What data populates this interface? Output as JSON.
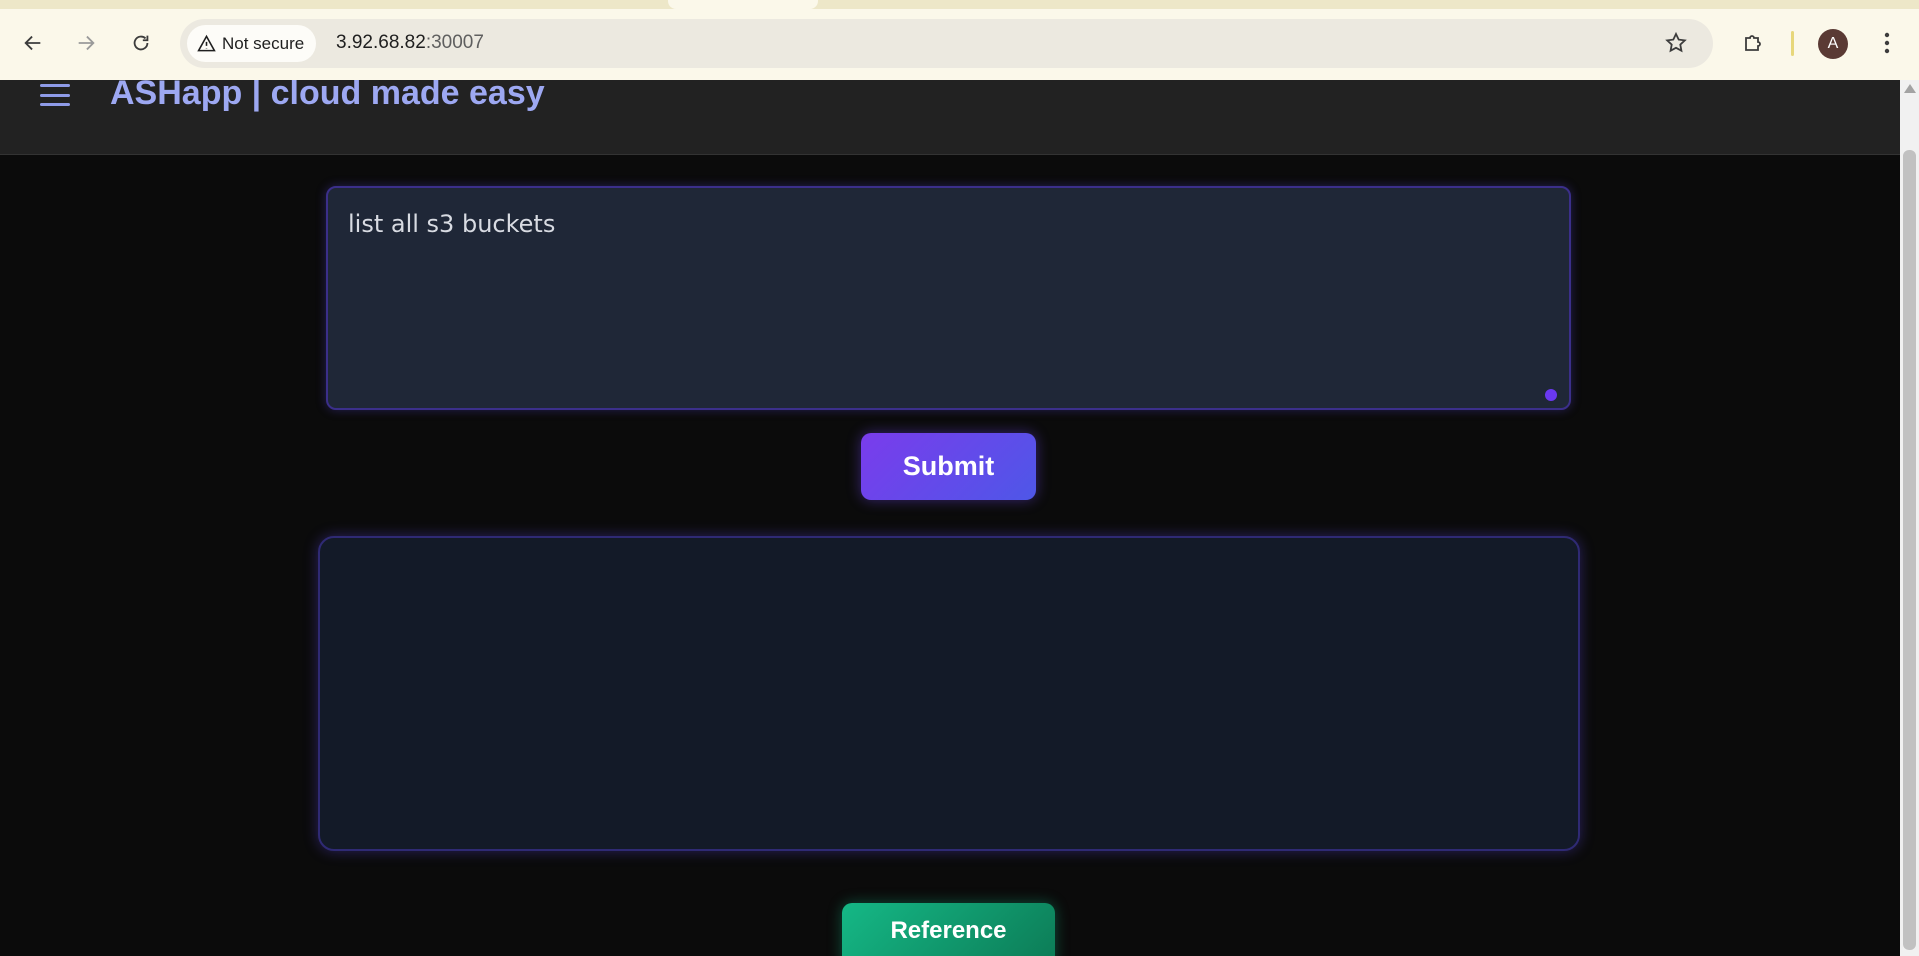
{
  "browser": {
    "security_label": "Not secure",
    "url_host": "3.92.68.82",
    "url_port": ":30007",
    "profile_initial": "A",
    "icons": {
      "back": "arrow-left-icon",
      "forward": "arrow-right-icon",
      "reload": "reload-icon",
      "security": "warning-triangle-icon",
      "bookmark": "star-icon",
      "extensions": "puzzle-icon",
      "menu": "more-vertical-icon"
    }
  },
  "app": {
    "title": "ASHapp | cloud made easy",
    "menu_icon": "hamburger-icon"
  },
  "main": {
    "prompt_value": "list all s3 buckets",
    "submit_label": "Submit",
    "output_text": "",
    "reference_label": "Reference"
  },
  "colors": {
    "title": "#9da8f2",
    "submit_gradient": [
      "#7a3cec",
      "#4e57e8"
    ],
    "reference_gradient": [
      "#15b886",
      "#0c7a55"
    ],
    "page_bg": "#0b0b0b",
    "header_bg": "#222222"
  }
}
